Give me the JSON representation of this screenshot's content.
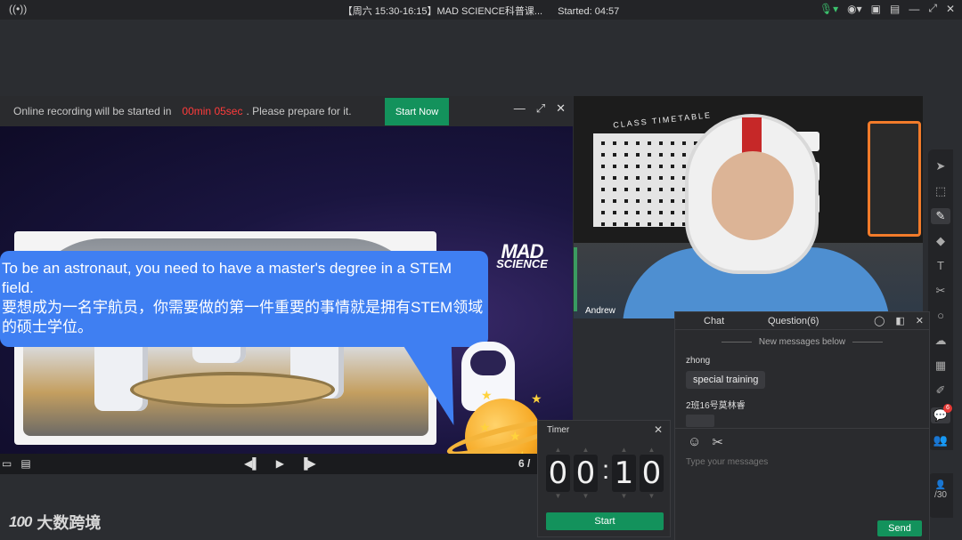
{
  "titlebar": {
    "title": "【周六 15:30-16:15】MAD SCIENCE科普课...",
    "started": "Started: 04:57"
  },
  "recording": {
    "message": "Online recording will be started in",
    "countdown": "00min 05sec",
    "suffix": ". Please prepare for it.",
    "start_now_label": "Start Now"
  },
  "slide": {
    "bubble_en": "To be an astronaut, you need to have a master's degree in a STEM field.",
    "bubble_cn": "要想成为一名宇航员，你需要做的第一件重要的事情就是拥有STEM领域的硕士学位。",
    "logo_top": "MAD",
    "logo_bottom": "SCIENCE",
    "page": "6 /"
  },
  "video": {
    "participant_name": "Andrew",
    "board_label": "CLASS TIMETABLE"
  },
  "chat": {
    "tab_chat": "Chat",
    "tab_question": "Question(6)",
    "new_messages": "New messages below",
    "messages": [
      {
        "sender": "zhong",
        "text": "special training"
      },
      {
        "sender": "2班16号莫林睿",
        "text": ""
      }
    ],
    "input_placeholder": "Type your messages",
    "send_label": "Send"
  },
  "timer": {
    "title": "Timer",
    "digits": [
      "0",
      "0",
      "1",
      "0"
    ],
    "start_label": "Start"
  },
  "users": {
    "count": "/30"
  },
  "brand": {
    "mark": "100",
    "name": "大数跨境"
  },
  "colors": {
    "accent_green": "#13925c",
    "countdown_red": "#ff3b3b",
    "bubble_blue": "#3f7ff2"
  }
}
